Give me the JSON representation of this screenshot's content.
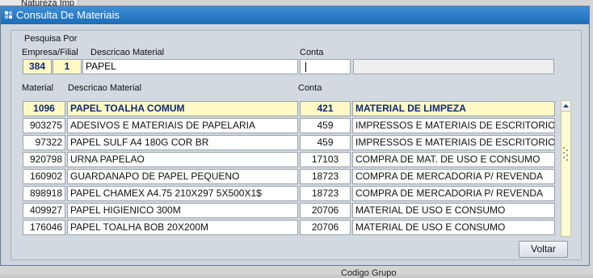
{
  "background": {
    "top_label": "Natureza Imp",
    "bottom_label": "Codigo Grupo"
  },
  "dialog": {
    "title": "Consulta De Materiais"
  },
  "search": {
    "group_label": "Pesquisa Por",
    "empresa_filial_label": "Empresa/Filial",
    "descricao_label": "Descricao Material",
    "conta_label": "Conta",
    "empresa": "384",
    "filial": "1",
    "descricao": "PAPEL",
    "conta": ""
  },
  "results": {
    "columns": {
      "material": "Material",
      "descricao": "Descricao Material",
      "conta": "Conta"
    },
    "rows": [
      {
        "material": "1096",
        "descricao": "PAPEL TOALHA COMUM",
        "conta": "421",
        "conta_desc": "MATERIAL DE LIMPEZA"
      },
      {
        "material": "903275",
        "descricao": "ADESIVOS E MATERIAIS DE PAPELARIA",
        "conta": "459",
        "conta_desc": "IMPRESSOS E MATERIAIS DE ESCRITORIO"
      },
      {
        "material": "97322",
        "descricao": "PAPEL SULF A4 180G COR BR",
        "conta": "459",
        "conta_desc": "IMPRESSOS E MATERIAIS DE ESCRITORIO"
      },
      {
        "material": "920798",
        "descricao": "URNA PAPELAO",
        "conta": "17103",
        "conta_desc": "COMPRA DE MAT. DE USO E CONSUMO"
      },
      {
        "material": "160902",
        "descricao": "GUARDANAPO DE PAPEL PEQUENO",
        "conta": "18723",
        "conta_desc": "COMPRA DE MERCADORIA P/ REVENDA"
      },
      {
        "material": "898918",
        "descricao": "PAPEL CHAMEX A4.75 210X297 5X500X1$",
        "conta": "18723",
        "conta_desc": "COMPRA DE MERCADORIA P/ REVENDA"
      },
      {
        "material": "409927",
        "descricao": "PAPEL HIGIENICO  300M",
        "conta": "20706",
        "conta_desc": "MATERIAL DE USO E CONSUMO"
      },
      {
        "material": "176046",
        "descricao": "PAPEL TOALHA BOB 20X200M",
        "conta": "20706",
        "conta_desc": "MATERIAL DE USO E CONSUMO"
      }
    ]
  },
  "buttons": {
    "voltar": "Voltar"
  },
  "icons": {
    "title": "window-icon",
    "scroll_up": "arrow-up-icon",
    "grip": "grip-icon"
  },
  "colors": {
    "title_bar": "#1c6cb8",
    "selected_row": "#fff9c4",
    "selected_text": "#0f2a7a"
  }
}
